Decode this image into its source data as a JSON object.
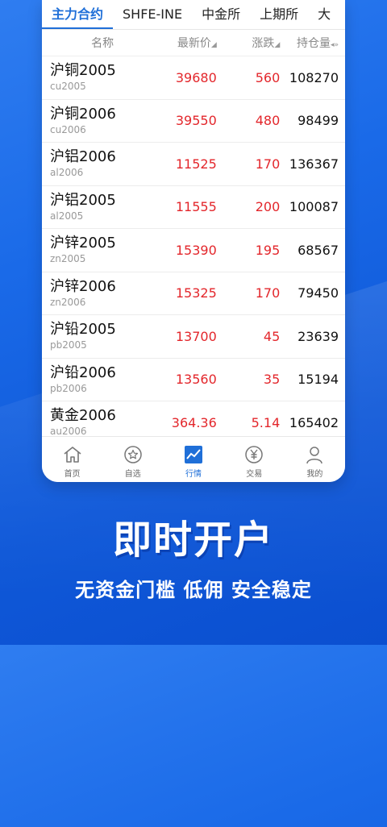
{
  "tabs": [
    "主力合约",
    "SHFE-INE",
    "中金所",
    "上期所",
    "大"
  ],
  "header": {
    "name": "名称",
    "price": "最新价",
    "change": "涨跌",
    "open_interest": "持仓量"
  },
  "rows": [
    {
      "name": "沪铜2005",
      "code": "cu2005",
      "price": "39680",
      "change": "560",
      "oi": "108270"
    },
    {
      "name": "沪铜2006",
      "code": "cu2006",
      "price": "39550",
      "change": "480",
      "oi": "98499"
    },
    {
      "name": "沪铝2006",
      "code": "al2006",
      "price": "11525",
      "change": "170",
      "oi": "136367"
    },
    {
      "name": "沪铝2005",
      "code": "al2005",
      "price": "11555",
      "change": "200",
      "oi": "100087"
    },
    {
      "name": "沪锌2005",
      "code": "zn2005",
      "price": "15390",
      "change": "195",
      "oi": "68567"
    },
    {
      "name": "沪锌2006",
      "code": "zn2006",
      "price": "15325",
      "change": "170",
      "oi": "79450"
    },
    {
      "name": "沪铅2005",
      "code": "pb2005",
      "price": "13700",
      "change": "45",
      "oi": "23639"
    },
    {
      "name": "沪铅2006",
      "code": "pb2006",
      "price": "13560",
      "change": "35",
      "oi": "15194"
    },
    {
      "name": "黄金2006",
      "code": "au2006",
      "price": "364.36",
      "change": "5.14",
      "oi": "165402"
    }
  ],
  "nav": [
    {
      "label": "首页",
      "icon": "home-icon"
    },
    {
      "label": "自选",
      "icon": "star-icon"
    },
    {
      "label": "行情",
      "icon": "chart-icon"
    },
    {
      "label": "交易",
      "icon": "yen-icon"
    },
    {
      "label": "我的",
      "icon": "user-icon"
    }
  ],
  "slogan": "即时开户",
  "sub_slogan": "无资金门槛 低佣 安全稳定",
  "colors": {
    "accent": "#1f6fd8",
    "up": "#e3262b",
    "background": "#1a6ae8"
  }
}
